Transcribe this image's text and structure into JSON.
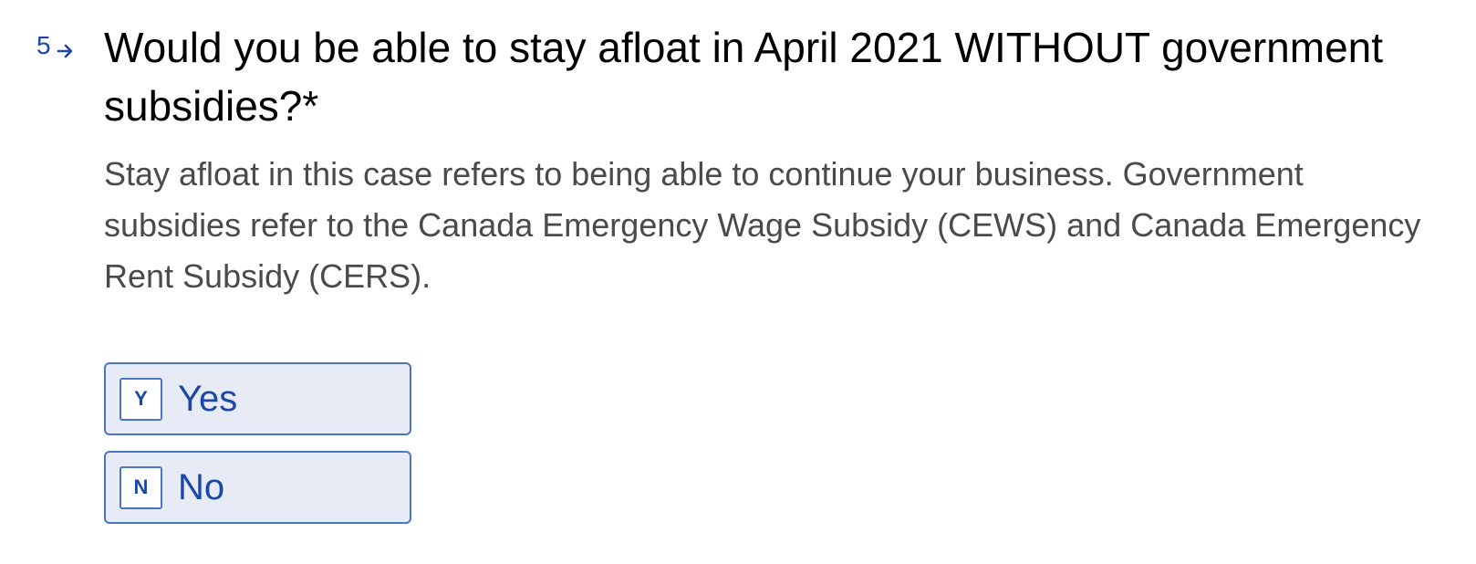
{
  "question": {
    "number": "5",
    "number_icon": "arrow-right-icon",
    "title": "Would you be able to stay afloat in April 2021 WITHOUT government subsidies?*",
    "description": "Stay afloat in this case refers to being able to continue your business. Government subsidies refer to the Canada Emergency Wage Subsidy (CEWS) and Canada Emergency Rent Subsidy (CERS).",
    "choices": [
      {
        "key": "Y",
        "label": "Yes"
      },
      {
        "key": "N",
        "label": "No"
      }
    ]
  },
  "colors": {
    "accent": "#1a47a8",
    "choice_border": "#4a74c7",
    "choice_background": "#e7ebf5",
    "title_text": "#000000",
    "description_text": "#4a4a4a"
  }
}
